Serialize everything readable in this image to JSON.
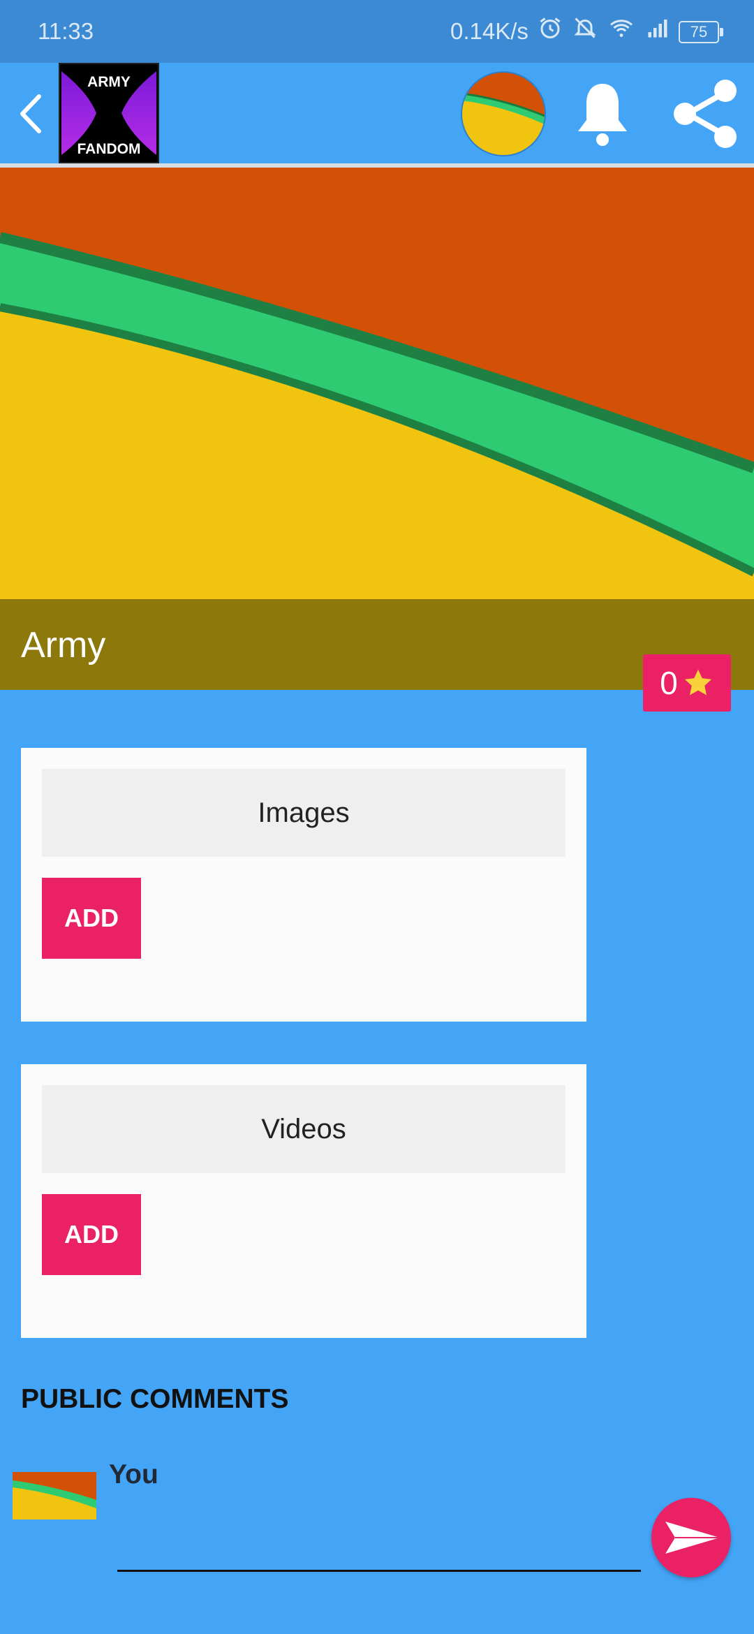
{
  "status_bar": {
    "time": "11:33",
    "network_speed": "0.14K/s",
    "battery": "75",
    "icons": [
      "alarm-icon",
      "mute-icon",
      "wifi-icon",
      "signal-icon",
      "battery-icon"
    ]
  },
  "toolbar": {
    "back_icon": "back-arrow-icon",
    "logo_text_top": "ARMY",
    "logo_text_bottom": "FANDOM",
    "profile_icon": "profile-avatar",
    "bell_icon": "bell-icon",
    "share_icon": "share-icon"
  },
  "group": {
    "title": "Army",
    "rating": "0",
    "rating_icon": "star-icon"
  },
  "sections": {
    "images": {
      "label": "Images",
      "add_label": "ADD"
    },
    "videos": {
      "label": "Videos",
      "add_label": "ADD"
    }
  },
  "comments": {
    "heading": "PUBLIC COMMENTS",
    "user": "You",
    "input_value": "",
    "send_icon": "send-icon"
  },
  "colors": {
    "background": "#44a5f7",
    "status_bar": "#3b8ad3",
    "accent_pink": "#ea2164",
    "title_band": "#8d780b",
    "card": "#fbfbfb",
    "card_header": "#efefef"
  }
}
